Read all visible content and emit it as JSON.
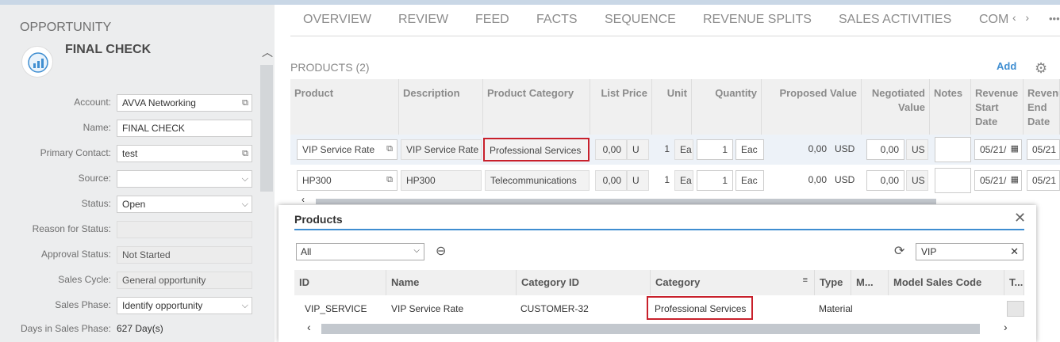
{
  "left": {
    "entity_type": "OPPORTUNITY",
    "title": "FINAL CHECK",
    "fields": [
      {
        "label": "Account:",
        "value": "AVVA Networking",
        "icon": "link-icon"
      },
      {
        "label": "Name:",
        "value": "FINAL CHECK"
      },
      {
        "label": "Primary Contact:",
        "value": "test",
        "icon": "link-icon"
      },
      {
        "label": "Source:",
        "value": "",
        "icon": "chevron-down-icon"
      },
      {
        "label": "Status:",
        "value": "Open",
        "icon": "chevron-down-icon"
      },
      {
        "label": "Reason for Status:",
        "value": ""
      },
      {
        "label": "Approval Status:",
        "value": "Not Started"
      },
      {
        "label": "Sales Cycle:",
        "value": "General opportunity"
      },
      {
        "label": "Sales Phase:",
        "value": "Identify opportunity",
        "icon": "chevron-down-icon"
      },
      {
        "label": "Days in Sales Phase:",
        "value": "627 Day(s)"
      }
    ]
  },
  "tabs": [
    "OVERVIEW",
    "REVIEW",
    "FEED",
    "FACTS",
    "SEQUENCE",
    "REVENUE SPLITS",
    "SALES ACTIVITIES",
    "COM"
  ],
  "products": {
    "title": "PRODUCTS (2)",
    "add_label": "Add",
    "columns": [
      "Product",
      "Description",
      "Product Category",
      "List Price",
      "Unit",
      "Quantity",
      "Proposed Value",
      "Negotiated Value",
      "Notes",
      "Revenue Start Date",
      "Revenue End Date"
    ],
    "rows": [
      {
        "product": "VIP Service Rate",
        "description": "VIP Service Rate",
        "category": "Professional Services",
        "list_price": "0,00",
        "list_unit": "U",
        "unit_qty": "1",
        "unit": "Ea",
        "quantity": "1",
        "qty_unit": "Eac",
        "proposed": "0,00",
        "proposed_cur": "USD",
        "negotiated": "0,00",
        "negotiated_cur": "US",
        "notes": "",
        "start": "05/21/",
        "end": "05/21"
      },
      {
        "product": "HP300",
        "description": "HP300",
        "category": "Telecommunications",
        "list_price": "0,00",
        "list_unit": "U",
        "unit_qty": "1",
        "unit": "Ea",
        "quantity": "1",
        "qty_unit": "Eac",
        "proposed": "0,00",
        "proposed_cur": "USD",
        "negotiated": "0,00",
        "negotiated_cur": "US",
        "notes": "",
        "start": "05/21/",
        "end": "05/21"
      }
    ]
  },
  "dialog": {
    "title": "Products",
    "filter_value": "All",
    "search_value": "VIP",
    "columns": [
      "ID",
      "Name",
      "Category ID",
      "Category",
      "Type",
      "M...",
      "Model Sales Code",
      "T..."
    ],
    "rows": [
      {
        "id": "VIP_SERVICE",
        "name": "VIP Service Rate",
        "category_id": "CUSTOMER-32",
        "category": "Professional Services",
        "type": "Material",
        "m": "",
        "model_sales_code": ""
      }
    ]
  },
  "colors": {
    "accent": "#3f8ed1",
    "highlight": "#c8202b",
    "panel": "#ecedee"
  }
}
